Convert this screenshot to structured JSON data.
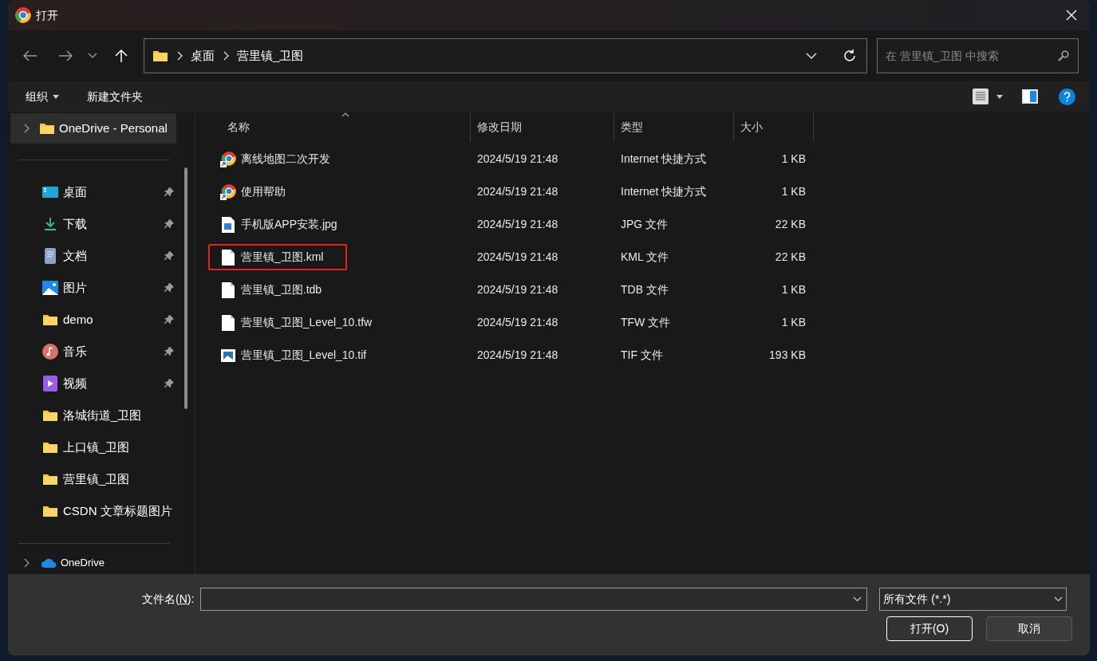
{
  "window": {
    "title": "打开"
  },
  "breadcrumb": [
    "桌面",
    "营里镇_卫图"
  ],
  "search": {
    "placeholder": "在 营里镇_卫图 中搜索"
  },
  "toolbar": {
    "organize": "组织",
    "new_folder": "新建文件夹"
  },
  "sidebar": {
    "top_item": {
      "label": "OneDrive - Personal",
      "expanded": false,
      "selected": true
    },
    "items": [
      {
        "label": "桌面",
        "kind": "desktop",
        "pinned": true
      },
      {
        "label": "下载",
        "kind": "download",
        "pinned": true
      },
      {
        "label": "文档",
        "kind": "documents",
        "pinned": true
      },
      {
        "label": "图片",
        "kind": "pictures",
        "pinned": true
      },
      {
        "label": "demo",
        "kind": "folder",
        "pinned": true
      },
      {
        "label": "音乐",
        "kind": "music",
        "pinned": true
      },
      {
        "label": "视频",
        "kind": "video",
        "pinned": true
      },
      {
        "label": "洛城街道_卫图",
        "kind": "folder",
        "pinned": false
      },
      {
        "label": "上口镇_卫图",
        "kind": "folder",
        "pinned": false
      },
      {
        "label": "营里镇_卫图",
        "kind": "folder",
        "pinned": false
      },
      {
        "label": "CSDN 文章标题图片",
        "kind": "folder",
        "pinned": false
      }
    ],
    "bottom_item": {
      "label": "OneDrive",
      "expanded": false,
      "selected": false
    }
  },
  "table": {
    "columns": [
      {
        "label": "名称",
        "sorted": true
      },
      {
        "label": "修改日期",
        "sorted": false
      },
      {
        "label": "类型",
        "sorted": false
      },
      {
        "label": "大小",
        "sorted": false
      }
    ],
    "rows": [
      {
        "name": "离线地图二次开发",
        "kind": "shortcut",
        "modified": "2024/5/19 21:48",
        "type": "Internet 快捷方式",
        "size": "1 KB",
        "highlighted": false
      },
      {
        "name": "使用帮助",
        "kind": "shortcut",
        "modified": "2024/5/19 21:48",
        "type": "Internet 快捷方式",
        "size": "1 KB",
        "highlighted": false
      },
      {
        "name": "手机版APP安装.jpg",
        "kind": "image",
        "modified": "2024/5/19 21:48",
        "type": "JPG 文件",
        "size": "22 KB",
        "highlighted": false
      },
      {
        "name": "营里镇_卫图.kml",
        "kind": "file",
        "modified": "2024/5/19 21:48",
        "type": "KML 文件",
        "size": "22 KB",
        "highlighted": true
      },
      {
        "name": "营里镇_卫图.tdb",
        "kind": "file",
        "modified": "2024/5/19 21:48",
        "type": "TDB 文件",
        "size": "1 KB",
        "highlighted": false
      },
      {
        "name": "营里镇_卫图_Level_10.tfw",
        "kind": "file",
        "modified": "2024/5/19 21:48",
        "type": "TFW 文件",
        "size": "1 KB",
        "highlighted": false
      },
      {
        "name": "营里镇_卫图_Level_10.tif",
        "kind": "tif",
        "modified": "2024/5/19 21:48",
        "type": "TIF 文件",
        "size": "193 KB",
        "highlighted": false
      }
    ]
  },
  "footer": {
    "filename_label": "文件名(**N**):",
    "filter": "所有文件 (*.*)",
    "open_button": "打开(O)",
    "cancel_button": "取消"
  }
}
